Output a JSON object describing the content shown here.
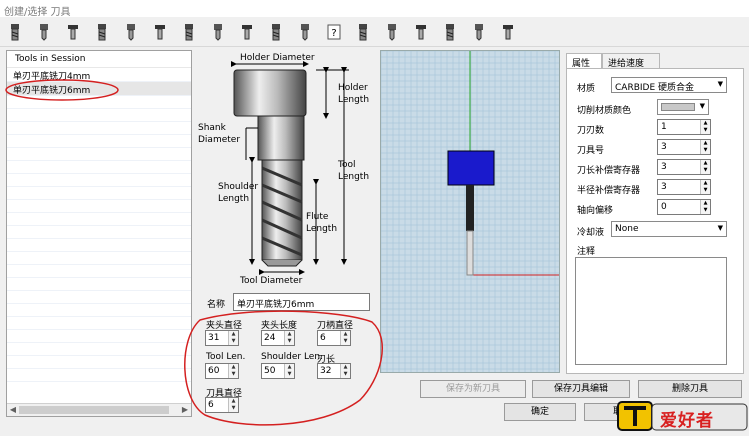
{
  "window": {
    "title": "创建/选择 刀具"
  },
  "toolbar": {
    "icons": [
      "flat-endmill-icon",
      "ball-endmill-icon",
      "bull-endmill-icon",
      "drill-icon",
      "center-drill-icon",
      "reamer-icon",
      "tap-icon",
      "chamfer-icon",
      "engrave-icon",
      "dovetail-icon",
      "lollipop-icon",
      "help-icon",
      "spot-drill-icon",
      "counterbore-icon",
      "thread-mill-icon",
      "form-tool-icon",
      "slot-cutter-icon",
      "side-cutter-icon"
    ]
  },
  "tools": {
    "header": "Tools in Session",
    "items": [
      "单刃平底铣刀4mm",
      "单刃平底铣刀6mm"
    ]
  },
  "diagram": {
    "holder_diameter": "Holder Diameter",
    "holder_length": [
      "Holder",
      "Length"
    ],
    "shank_diameter": [
      "Shank",
      "Diameter"
    ],
    "tool_length": [
      "Tool",
      "Length"
    ],
    "shoulder_length": [
      "Shoulder",
      "Length"
    ],
    "flute_length": [
      "Flute",
      "Length"
    ],
    "tool_diameter": "Tool Diameter"
  },
  "name": {
    "label": "名称",
    "value": "单刃平底铣刀6mm"
  },
  "params": [
    {
      "label": "夹头直径",
      "value": "31"
    },
    {
      "label": "夹头长度",
      "value": "24"
    },
    {
      "label": "刀柄直径",
      "value": "6"
    },
    {
      "label": "Tool Len.",
      "value": "60"
    },
    {
      "label": "Shoulder Len.",
      "value": "50"
    },
    {
      "label": "刃长",
      "value": "32"
    },
    {
      "label": "刀具直径",
      "value": "6"
    }
  ],
  "tabs": [
    "属性",
    "进给速度"
  ],
  "properties": {
    "material_label": "材质",
    "material_value": "CARBIDE 硬质合金",
    "color_label": "切削材质颜色",
    "flutes_label": "刀刃数",
    "flutes_value": "1",
    "tool_no_label": "刀具号",
    "tool_no_value": "3",
    "len_offset_label": "刀长补偿寄存器",
    "len_offset_value": "3",
    "rad_offset_label": "半径补偿寄存器",
    "rad_offset_value": "3",
    "axial_offset_label": "轴向偏移",
    "axial_offset_value": "0",
    "coolant_label": "冷却液",
    "coolant_value": "None",
    "notes_label": "注释"
  },
  "buttons": {
    "save_new": "保存为新刀具",
    "save_edit": "保存刀具编辑",
    "delete": "删除刀具",
    "ok": "确定",
    "cancel": "取"
  },
  "watermark": {
    "text": "爱好者"
  },
  "colors": {
    "tool_holder": "#1a1acc",
    "annotation": "#d42020",
    "preview_bg": "#c9dbe7"
  }
}
